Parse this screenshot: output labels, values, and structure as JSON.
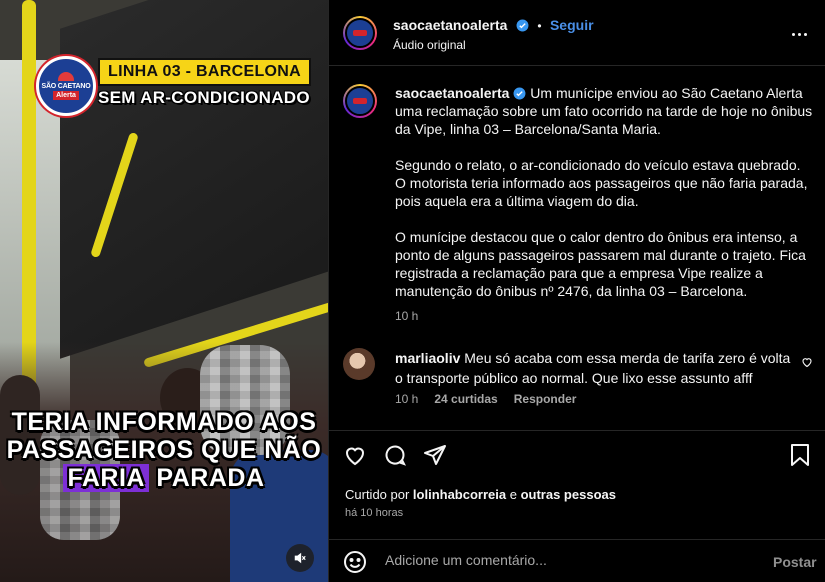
{
  "media": {
    "badge_line1": "SÃO CAETANO",
    "badge_line2": "Alerta",
    "tag_line1": "LINHA 03 - BARCELONA",
    "tag_line2": "SEM AR-CONDICIONADO",
    "caption_line1": "TERIA INFORMADO AOS",
    "caption_line2": "PASSAGEIROS QUE NÃO",
    "caption_line3": "FARIA",
    "caption_line3b": "PARADA"
  },
  "header": {
    "username": "saocaetanoalerta",
    "separator": "•",
    "follow_label": "Seguir",
    "audio": "Áudio original"
  },
  "post": {
    "username": "saocaetanoalerta",
    "caption": " Um munícipe enviou ao São Caetano Alerta uma reclamação sobre um fato ocorrido na tarde de hoje no ônibus da Vipe, linha 03 – Barcelona/Santa Maria.\n\nSegundo o relato, o ar-condicionado do veículo estava quebrado. O motorista teria informado aos passageiros que não faria parada, pois aquela era a última viagem do dia.\n\nO munícipe destacou que o calor dentro do ônibus era intenso, a ponto de alguns passageiros passarem mal durante o trajeto. Fica registrada a reclamação para que a empresa Vipe realize a manutenção do ônibus nº 2476, da linha 03 – Barcelona.",
    "time": "10 h"
  },
  "comments": [
    {
      "username": "marliaoliv",
      "text": " Meu só acaba com essa merda de tarifa zero é volta o transporte público ao normal. Que lixo esse assunto afff",
      "time": "10 h",
      "likes": "24 curtidas",
      "reply": "Responder"
    }
  ],
  "footer": {
    "liked_prefix": "Curtido por ",
    "liked_user": "lolinhabcorreia",
    "liked_mid": " e ",
    "liked_rest": "outras pessoas",
    "time_ago": "há 10 horas",
    "comment_placeholder": "Adicione um comentário...",
    "post_label": "Postar"
  },
  "colors": {
    "accent": "#4a8fe7",
    "bg": "#000000",
    "muted": "#a8a8a8",
    "highlight": "#7d2fd6",
    "tag_yellow": "#f6d417"
  }
}
